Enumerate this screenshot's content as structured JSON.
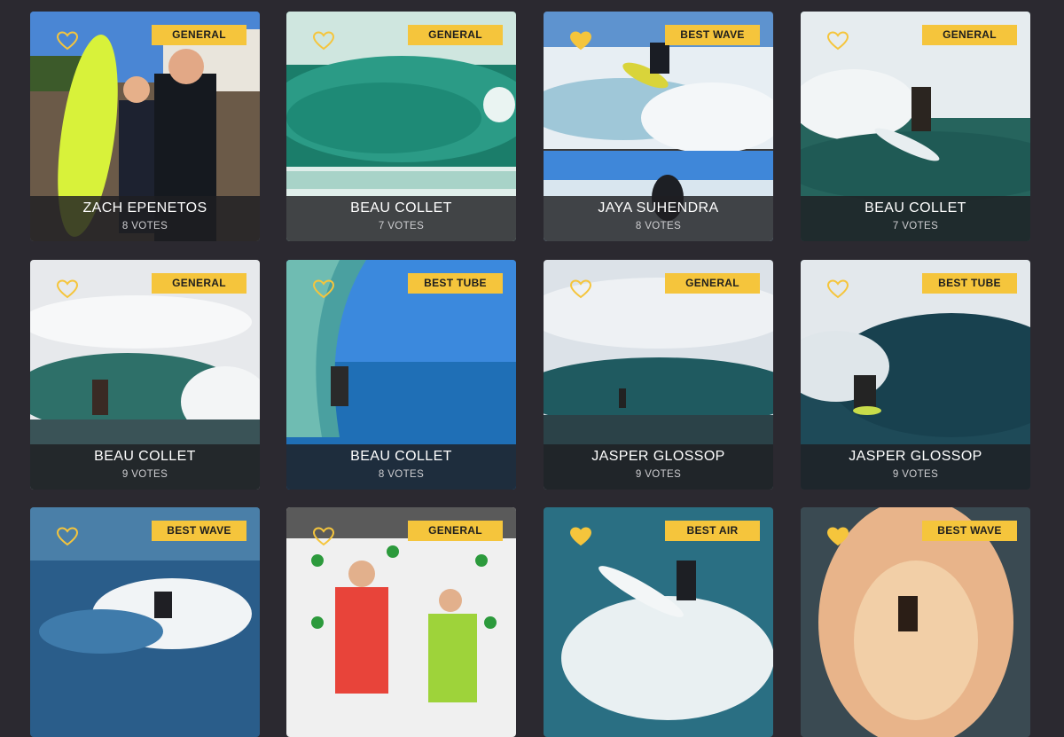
{
  "colors": {
    "badge": "#f5c53c",
    "heart": "#f5c53c",
    "background": "#2b2930"
  },
  "cards": [
    {
      "category": "GENERAL",
      "name": "ZACH EPENETOS",
      "votes": "8 VOTES",
      "liked": false,
      "scene": "beach-portrait"
    },
    {
      "category": "GENERAL",
      "name": "BEAU COLLET",
      "votes": "7 VOTES",
      "liked": false,
      "scene": "green-barrel"
    },
    {
      "category": "BEST WAVE",
      "name": "JAYA SUHENDRA",
      "votes": "8 VOTES",
      "liked": true,
      "scene": "split-shot"
    },
    {
      "category": "GENERAL",
      "name": "BEAU COLLET",
      "votes": "7 VOTES",
      "liked": false,
      "scene": "air-turn"
    },
    {
      "category": "GENERAL",
      "name": "BEAU COLLET",
      "votes": "9 VOTES",
      "liked": false,
      "scene": "cloudy-wave"
    },
    {
      "category": "BEST TUBE",
      "name": "BEAU COLLET",
      "votes": "8 VOTES",
      "liked": false,
      "scene": "tube-blue"
    },
    {
      "category": "GENERAL",
      "name": "JASPER GLOSSOP",
      "votes": "9 VOTES",
      "liked": false,
      "scene": "long-wall"
    },
    {
      "category": "BEST TUBE",
      "name": "JASPER GLOSSOP",
      "votes": "9 VOTES",
      "liked": false,
      "scene": "dark-barrel"
    },
    {
      "category": "BEST WAVE",
      "name": "",
      "votes": "",
      "liked": false,
      "scene": "white-spray"
    },
    {
      "category": "GENERAL",
      "name": "",
      "votes": "",
      "liked": false,
      "scene": "podium"
    },
    {
      "category": "BEST AIR",
      "name": "",
      "votes": "",
      "liked": true,
      "scene": "aerial"
    },
    {
      "category": "BEST WAVE",
      "name": "",
      "votes": "",
      "liked": true,
      "scene": "sunset-spray"
    }
  ]
}
